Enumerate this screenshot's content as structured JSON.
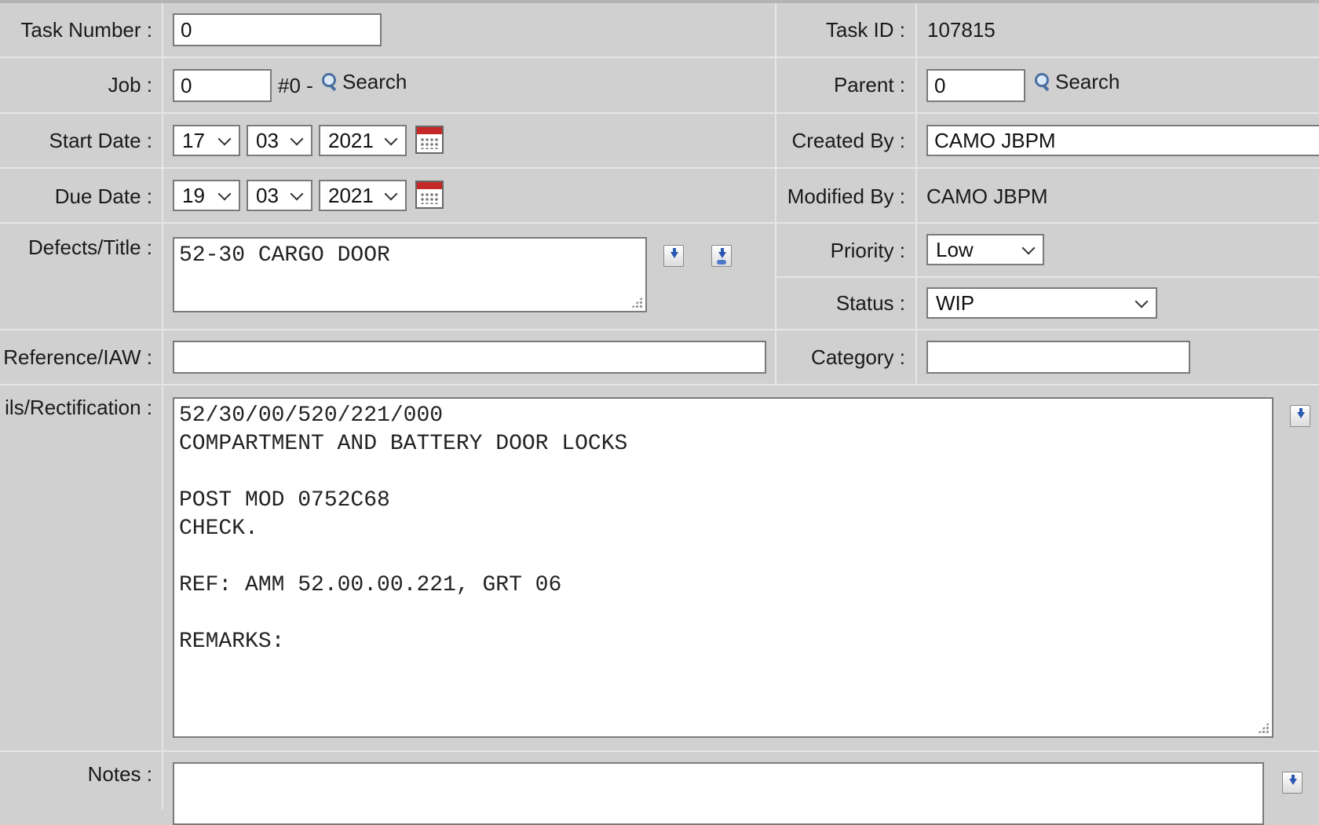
{
  "form": {
    "task_number": {
      "label": "Task Number :",
      "value": "0"
    },
    "task_id": {
      "label": "Task ID :",
      "value": "107815"
    },
    "job": {
      "label": "Job :",
      "value": "0",
      "suffix": "#0 -",
      "search_label": "Search"
    },
    "parent": {
      "label": "Parent :",
      "value": "0",
      "search_label": "Search"
    },
    "start_date": {
      "label": "Start Date :",
      "day": "17",
      "month": "03",
      "year": "2021"
    },
    "created_by": {
      "label": "Created By :",
      "value": "CAMO JBPM"
    },
    "due_date": {
      "label": "Due Date :",
      "day": "19",
      "month": "03",
      "year": "2021"
    },
    "modified_by": {
      "label": "Modified By :",
      "value": "CAMO JBPM"
    },
    "defects_title": {
      "label": "Defects/Title :",
      "value": "52-30 CARGO DOOR"
    },
    "priority": {
      "label": "Priority :",
      "value": "Low"
    },
    "status": {
      "label": "Status :",
      "value": "WIP"
    },
    "reference": {
      "label": "Reference/IAW :",
      "value": ""
    },
    "category": {
      "label": "Category :",
      "value": ""
    },
    "details": {
      "label": "ils/Rectification :",
      "value": "52/30/00/520/221/000\nCOMPARTMENT AND BATTERY DOOR LOCKS\n\nPOST MOD 0752C68\nCHECK.\n\nREF: AMM 52.00.00.221, GRT 06\n\nREMARKS:"
    },
    "notes": {
      "label": "Notes :",
      "value": ""
    }
  },
  "colors": {
    "background": "#d0d0d0",
    "separator": "#e6e6e6",
    "calendar_red": "#c62828",
    "icon_blue": "#2a58b0"
  },
  "icons": [
    "search-icon",
    "calendar-icon",
    "insert-text-icon",
    "insert-template-icon"
  ]
}
